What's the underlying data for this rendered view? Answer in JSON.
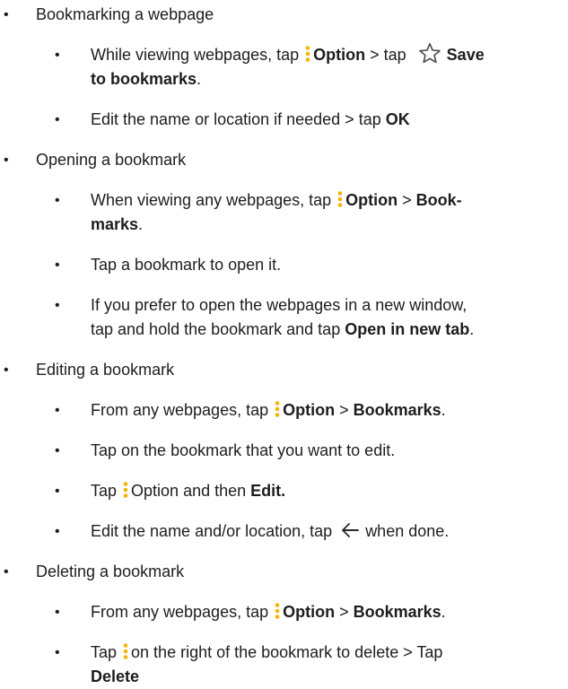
{
  "bullet_char": "•",
  "icons": {
    "option": "three-dot-vertical-icon",
    "star": "star-outline-icon",
    "back": "back-arrow-icon",
    "icon_color": "#f4b400"
  },
  "sections": [
    {
      "heading": "Bookmarking a webpage",
      "steps": [
        {
          "a": "While viewing webpages, tap ",
          "b": "Option",
          "c": " > tap ",
          "d": "Save",
          "e": "to bookmarks",
          "f": "."
        },
        {
          "a": "Edit the name or location if needed > tap ",
          "b": "OK"
        }
      ]
    },
    {
      "heading": "Opening a bookmark",
      "steps": [
        {
          "a": "When viewing any webpages, tap ",
          "b": "Option",
          "c": " > ",
          "d": "Book-",
          "e": "marks",
          "f": "."
        },
        {
          "a": "Tap a bookmark to open it."
        },
        {
          "a": "If you prefer to open the webpages in a new window,",
          "b": "tap and hold the bookmark and tap ",
          "c": "Open in new tab",
          "d": "."
        }
      ]
    },
    {
      "heading": "Editing a bookmark",
      "steps": [
        {
          "a": "From any webpages, tap ",
          "b": "Option",
          "c": " > ",
          "d": "Bookmarks",
          "e": "."
        },
        {
          "a": "Tap on the bookmark that you want to edit."
        },
        {
          "a": "Tap ",
          "b": "Option and then ",
          "c": "Edit."
        },
        {
          "a": "Edit the name and/or location, tap ",
          "b": "when done."
        }
      ]
    },
    {
      "heading": "Deleting a bookmark",
      "steps": [
        {
          "a": "From any webpages, tap ",
          "b": "Option",
          "c": " > ",
          "d": "Bookmarks",
          "e": "."
        },
        {
          "a": "Tap ",
          "b": "on the right of the bookmark to delete > Tap",
          "c": "Delete"
        }
      ]
    }
  ]
}
